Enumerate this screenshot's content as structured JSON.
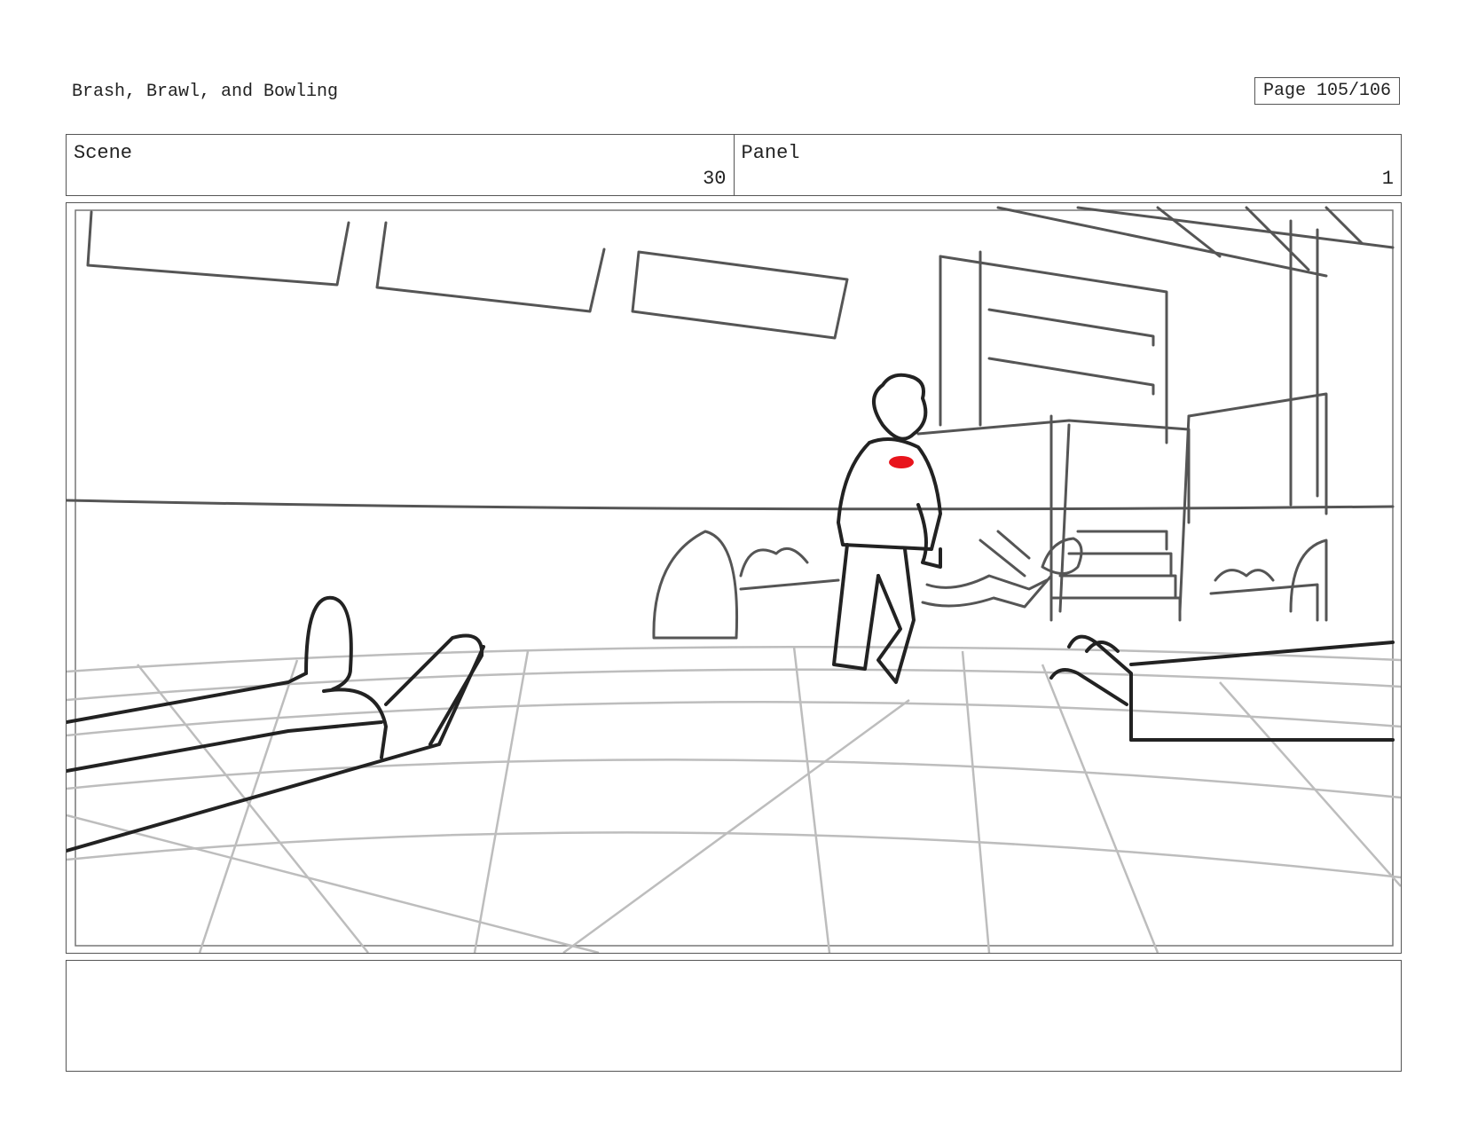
{
  "document": {
    "title": "Brash, Brawl, and Bowling",
    "page": "Page 105/106"
  },
  "header": {
    "scene": {
      "label": "Scene",
      "value": "30"
    },
    "panel": {
      "label": "Panel",
      "value": "1"
    }
  },
  "notes": {
    "text": ""
  },
  "colors": {
    "accent": "#e8141c",
    "line": "#555555",
    "sketch": "#222222"
  }
}
